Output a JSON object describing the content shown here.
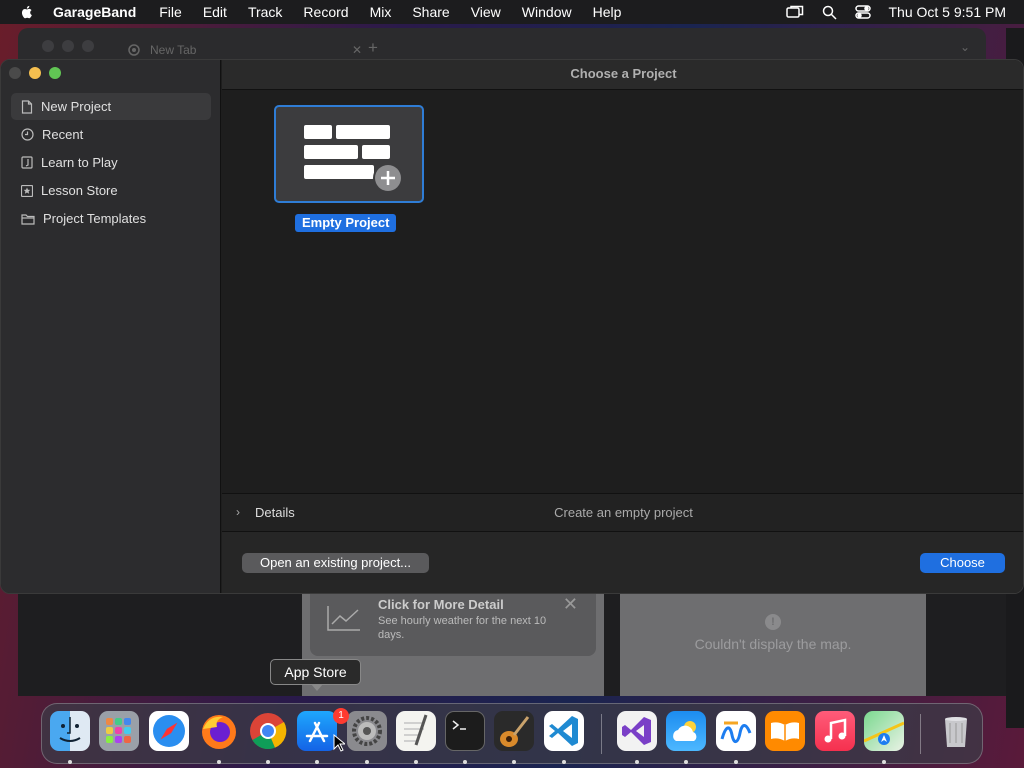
{
  "menubar": {
    "app_name": "GarageBand",
    "items": [
      "File",
      "Edit",
      "Track",
      "Record",
      "Mix",
      "Share",
      "View",
      "Window",
      "Help"
    ],
    "datetime": "Thu Oct 5  9:51 PM"
  },
  "background_browser": {
    "tab_title": "New Tab"
  },
  "background_weather": {
    "card_title": "Click for More Detail",
    "card_subtitle": "See hourly weather for the next 10 days.",
    "map_message": "Couldn't display the map."
  },
  "window": {
    "title": "Choose a Project",
    "sidebar": {
      "items": [
        {
          "label": "New Project",
          "icon": "document-icon",
          "selected": true
        },
        {
          "label": "Recent",
          "icon": "clock-icon",
          "selected": false
        },
        {
          "label": "Learn to Play",
          "icon": "music-note-icon",
          "selected": false
        },
        {
          "label": "Lesson Store",
          "icon": "star-icon",
          "selected": false
        },
        {
          "label": "Project Templates",
          "icon": "folder-icon",
          "selected": false
        }
      ]
    },
    "project": {
      "label": "Empty Project"
    },
    "details": {
      "label": "Details",
      "description": "Create an empty project"
    },
    "buttons": {
      "open_existing": "Open an existing project...",
      "choose": "Choose"
    }
  },
  "tooltip": {
    "text": "App Store"
  },
  "dock": {
    "apps": [
      {
        "name": "Finder",
        "icon": "finder-icon",
        "running": true
      },
      {
        "name": "Launchpad",
        "icon": "launchpad-icon",
        "running": false
      },
      {
        "name": "Safari",
        "icon": "safari-icon",
        "running": false
      },
      {
        "name": "Firefox",
        "icon": "firefox-icon",
        "running": true
      },
      {
        "name": "Chrome",
        "icon": "chrome-icon",
        "running": true
      },
      {
        "name": "App Store",
        "icon": "app-store-icon",
        "running": true
      },
      {
        "name": "System Settings",
        "icon": "settings-icon",
        "running": true,
        "badge": "1"
      },
      {
        "name": "TextEdit",
        "icon": "textedit-icon",
        "running": true
      },
      {
        "name": "Terminal",
        "icon": "terminal-icon",
        "running": true
      },
      {
        "name": "GarageBand",
        "icon": "garageband-icon",
        "running": true
      },
      {
        "name": "Visual Studio Code",
        "icon": "vscode-icon",
        "running": true
      },
      {
        "name": "Visual Studio",
        "icon": "visual-studio-icon",
        "running": true
      },
      {
        "name": "Weather",
        "icon": "weather-icon",
        "running": true
      },
      {
        "name": "Freeform",
        "icon": "freeform-icon",
        "running": true
      },
      {
        "name": "Books",
        "icon": "books-icon",
        "running": false
      },
      {
        "name": "Music",
        "icon": "music-icon",
        "running": false
      },
      {
        "name": "Maps",
        "icon": "maps-icon",
        "running": true
      },
      {
        "name": "Trash",
        "icon": "trash-icon",
        "running": false
      }
    ]
  },
  "colors": {
    "accent": "#1f6fe0",
    "selection_border": "#2f7dd6",
    "badge": "#ff3b30"
  }
}
